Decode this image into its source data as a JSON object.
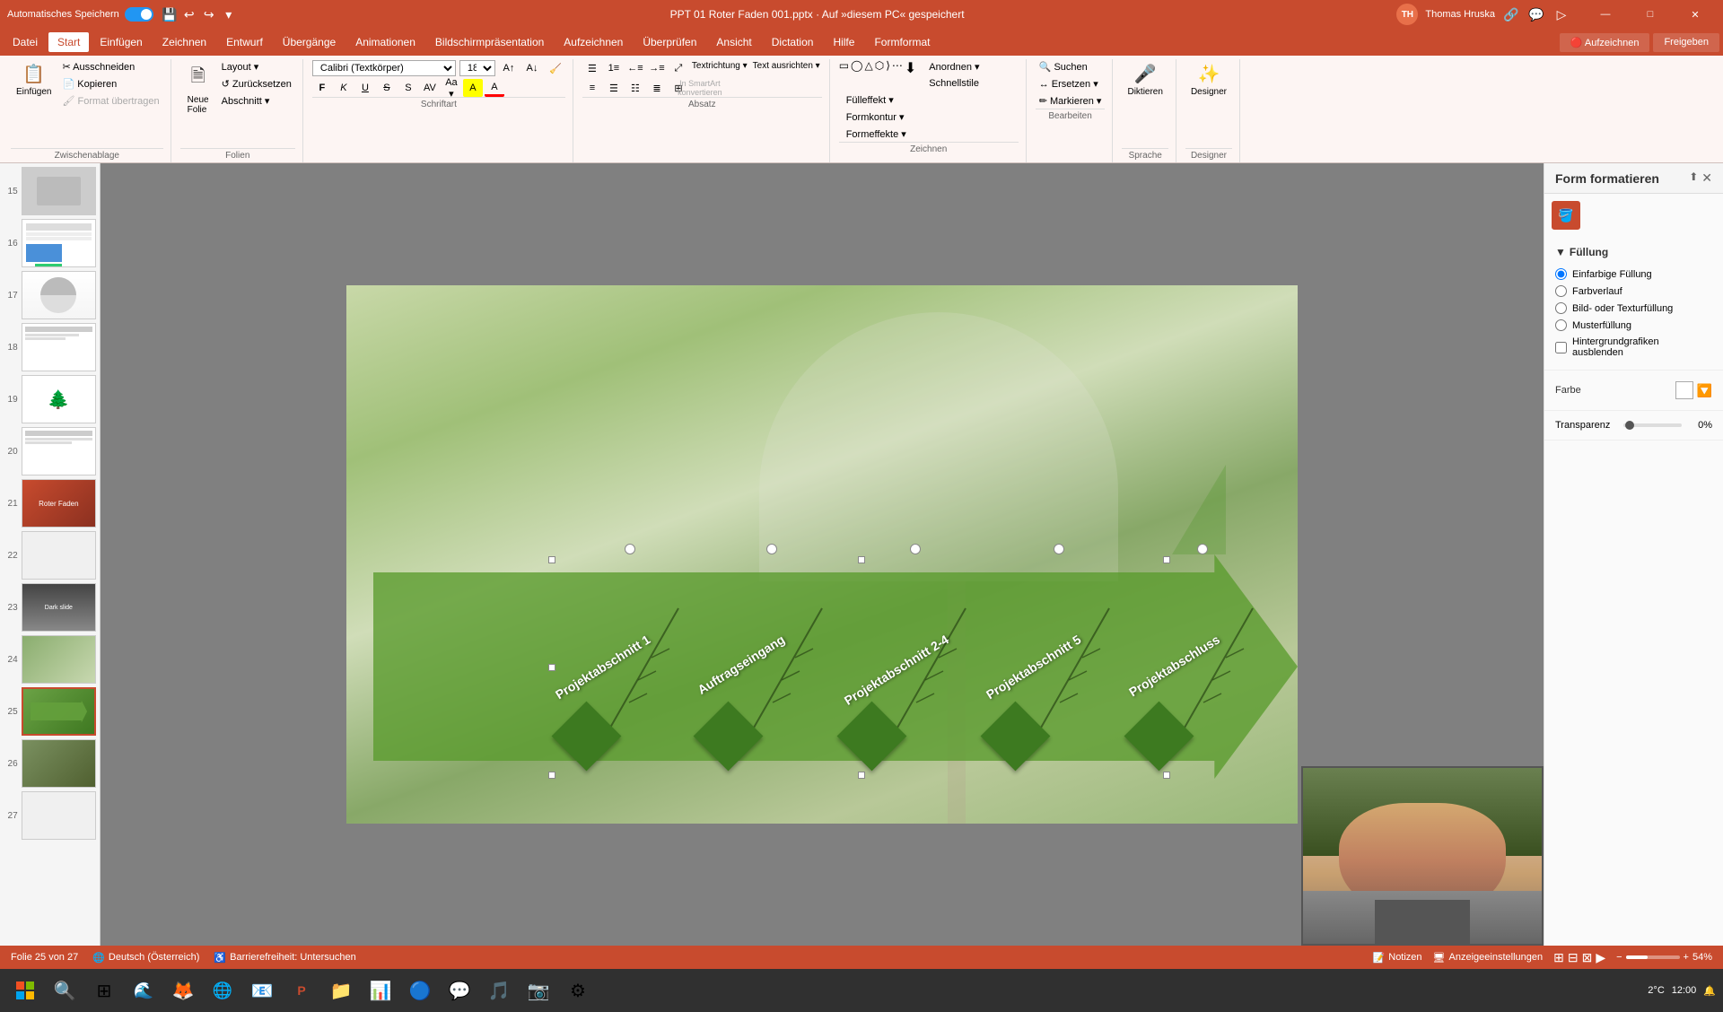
{
  "app": {
    "title": "PPT 01 Roter Faden 001.pptx - Auf 'diesem PC' gespeichert",
    "autosave_label": "Automatisches Speichern",
    "window_controls": [
      "—",
      "□",
      "✕"
    ]
  },
  "titlebar": {
    "autosave": "Automatisches Speichern",
    "filename": "PPT 01 Roter Faden 001.pptx · Auf »diesem PC« gespeichert",
    "user": "Thomas Hruska",
    "user_initials": "TH"
  },
  "menu": {
    "items": [
      "Datei",
      "Start",
      "Einfügen",
      "Zeichnen",
      "Entwurf",
      "Übergänge",
      "Animationen",
      "Bildschirmpräsentation",
      "Aufzeichnen",
      "Überprüfen",
      "Ansicht",
      "Dictation",
      "Hilfe",
      "Formformat"
    ]
  },
  "ribbon": {
    "groups": [
      {
        "name": "Zwischenablage",
        "items": [
          "Einfügen",
          "Ausschneiden",
          "Kopieren",
          "Format übertragen"
        ]
      },
      {
        "name": "Folien",
        "items": [
          "Neue Folie",
          "Layout",
          "Zurücksetzen",
          "Abschnitt"
        ]
      },
      {
        "name": "Schriftart",
        "font": "Calibri (Textkörper)",
        "size": "18",
        "bold": "F",
        "italic": "K",
        "underline": "U",
        "strikethrough": "S"
      },
      {
        "name": "Absatz"
      },
      {
        "name": "Zeichnen"
      },
      {
        "name": "Bearbeiten",
        "items": [
          "Suchen",
          "Ersetzen",
          "Markieren"
        ]
      },
      {
        "name": "Sprache",
        "items": [
          "Diktieren"
        ]
      },
      {
        "name": "Designer"
      }
    ],
    "right_buttons": [
      "Aufzeichnen",
      "Freigeben"
    ]
  },
  "slides": [
    {
      "num": 15,
      "class": "thumb-content-15"
    },
    {
      "num": 16,
      "class": "thumb-content-16"
    },
    {
      "num": 17,
      "class": "thumb-content-17"
    },
    {
      "num": 18,
      "class": "thumb-content-18"
    },
    {
      "num": 19,
      "class": "thumb-content-19"
    },
    {
      "num": 20,
      "class": "thumb-content-20"
    },
    {
      "num": 21,
      "class": "thumb-content-21"
    },
    {
      "num": 22,
      "class": "thumb-content-22"
    },
    {
      "num": 23,
      "class": "thumb-content-23"
    },
    {
      "num": 24,
      "class": "thumb-content-24"
    },
    {
      "num": 25,
      "class": "thumb-content-25",
      "active": true
    },
    {
      "num": 26,
      "class": "thumb-content-26"
    },
    {
      "num": 27,
      "class": "thumb-content-27"
    }
  ],
  "slide_content": {
    "fishbone_labels": [
      "Projektabschnitt 1",
      "Auftragseingang",
      "Projektabschnitt 2-4",
      "Projektabschnitt 5",
      "Projektabschluss"
    ],
    "diamonds_count": 5
  },
  "right_panel": {
    "title": "Form formatieren",
    "sections": {
      "fill": {
        "label": "Füllung",
        "options": [
          {
            "id": "solid",
            "label": "Einfarbige Füllung",
            "checked": true
          },
          {
            "id": "gradient",
            "label": "Farbverlauf",
            "checked": false
          },
          {
            "id": "picture",
            "label": "Bild- oder Texturfüllung",
            "checked": false
          },
          {
            "id": "pattern",
            "label": "Musterfüllung",
            "checked": false
          }
        ],
        "checkbox": "Hintergrundgrafiken ausblenden"
      },
      "color": {
        "label": "Farbe",
        "value": "#ffffff"
      },
      "transparency": {
        "label": "Transparenz",
        "value": "0%",
        "slider_pos": 0
      }
    }
  },
  "statusbar": {
    "slide_info": "Folie 25 von 27",
    "language": "Deutsch (Österreich)",
    "accessibility": "Barrierefreiheit: Untersuchen",
    "notes": "Notizen",
    "settings": "Anzeigeeinstellungen"
  },
  "taskbar": {
    "time": "2°C",
    "taskbar_items": [
      "⊞",
      "🔍",
      "⬛",
      "🦊",
      "⬛",
      "⬛",
      "📧",
      "⬛",
      "⬛",
      "🎵",
      "⬛",
      "⬛",
      "⬛",
      "⬛",
      "⬛"
    ]
  }
}
